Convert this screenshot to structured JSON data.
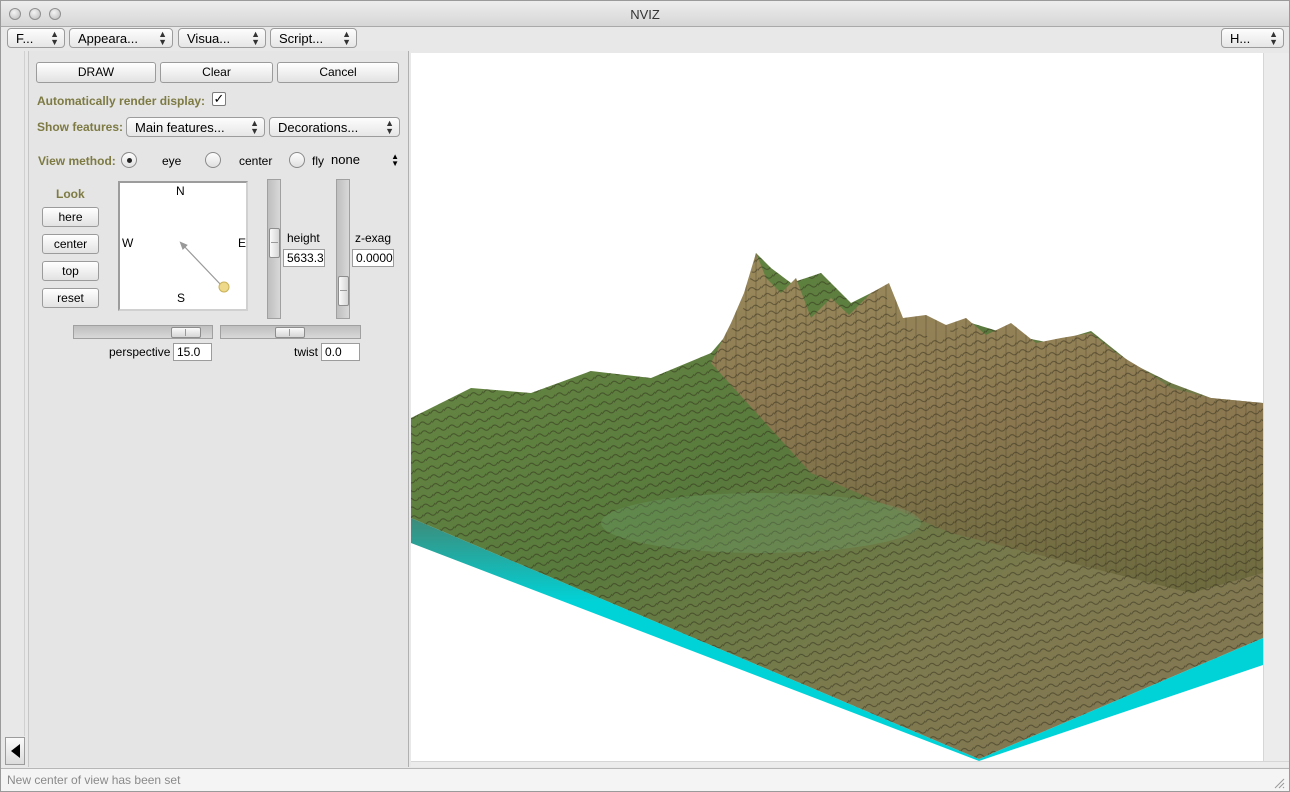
{
  "window": {
    "title": "NVIZ"
  },
  "menubar": {
    "file_label": "F...",
    "appearance_label": "Appeara...",
    "visualize_label": "Visua...",
    "scripting_label": "Script...",
    "help_label": "H..."
  },
  "toolbar": {
    "draw_label": "DRAW",
    "clear_label": "Clear",
    "cancel_label": "Cancel"
  },
  "auto_render": {
    "label": "Automatically render display:",
    "checked": true,
    "check_mark": "✓"
  },
  "show_features": {
    "label": "Show features:",
    "main_features": "Main features...",
    "decorations": "Decorations..."
  },
  "view_method": {
    "label": "View method:",
    "options": [
      "eye",
      "center",
      "fly"
    ],
    "selected": "eye",
    "fly_mode": "none"
  },
  "look": {
    "label": "Look",
    "buttons": [
      "here",
      "center",
      "top",
      "reset"
    ]
  },
  "compass": {
    "north": "N",
    "south": "S",
    "east": "E",
    "west": "W"
  },
  "height": {
    "label": "height",
    "value": "5633.3",
    "slider_fraction": 0.55
  },
  "zexag": {
    "label": "z-exag",
    "value": "0.0000",
    "slider_fraction": 0.1
  },
  "perspective": {
    "label": "perspective",
    "value": "15.0",
    "slider_fraction": 0.8
  },
  "twist": {
    "label": "twist",
    "value": "0.0",
    "slider_fraction": 0.5
  },
  "status": {
    "message": "New center of view has been set"
  },
  "colors": {
    "accent_label": "#7d7a43",
    "water": "#00d3d8",
    "terrain_high": "#8a7a4e",
    "terrain_low": "#5d7a3e"
  }
}
